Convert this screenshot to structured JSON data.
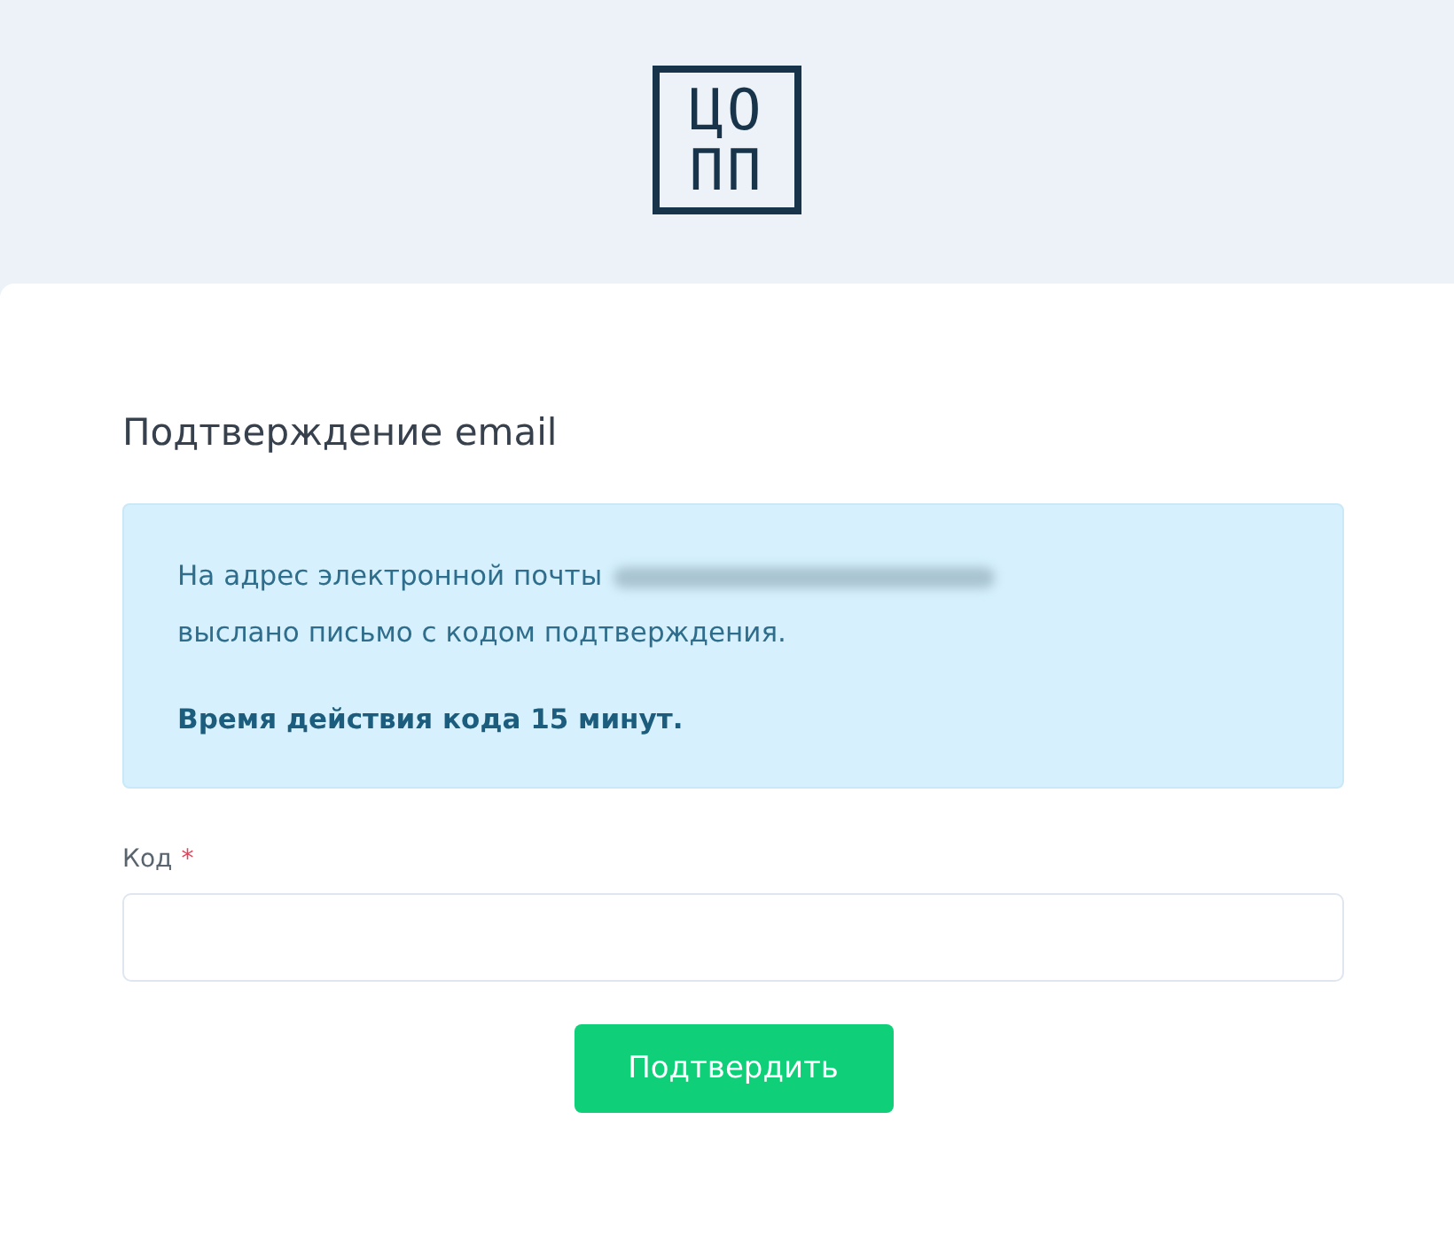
{
  "logo": {
    "lines": [
      "ЦО",
      "ПП"
    ]
  },
  "title": "Подтверждение email",
  "info": {
    "line_1": "На адрес электронной почты",
    "email_redacted": true,
    "line_2": "выслано письмо с кодом подтверждения.",
    "note": "Время действия кода 15 минут."
  },
  "code_field": {
    "label": "Код",
    "required": true,
    "required_mark": "*"
  },
  "submit_button": "Подтвердить"
}
